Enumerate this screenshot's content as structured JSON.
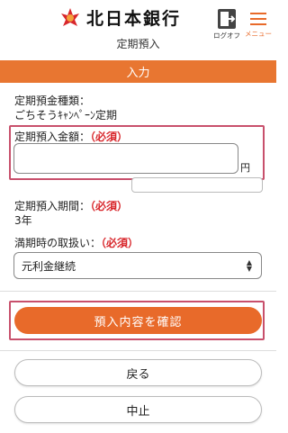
{
  "header": {
    "bank_name": "北日本銀行",
    "logout_label": "ログオフ",
    "menu_label": "メニュー",
    "page_title": "定期預入"
  },
  "section": {
    "title": "入力"
  },
  "deposit_type": {
    "label": "定期預金種類：",
    "value": "ごちそうｷｬﾝﾍﾟｰﾝ定期"
  },
  "amount": {
    "label": "定期預入金額：",
    "required": "（必須）",
    "value": "",
    "unit": "円"
  },
  "period": {
    "label": "定期預入期間：",
    "required": "（必須）",
    "value": "3年"
  },
  "maturity": {
    "label": "満期時の取扱い：",
    "required": "（必須）",
    "selected": "元利金継続"
  },
  "buttons": {
    "confirm": "預入内容を確認",
    "back": "戻る",
    "cancel": "中止"
  },
  "colors": {
    "accent": "#e86a2a",
    "highlight": "#c8506c",
    "required": "#d8262b"
  }
}
